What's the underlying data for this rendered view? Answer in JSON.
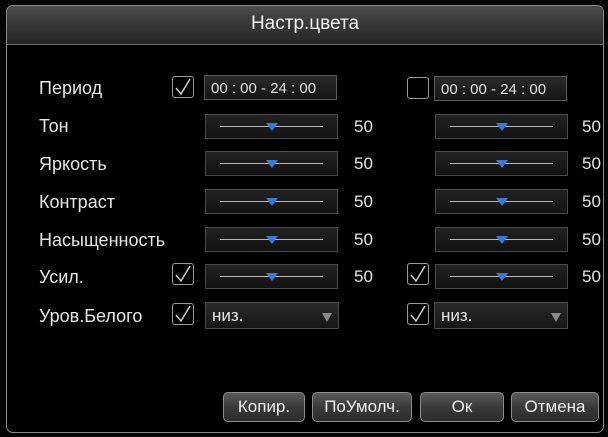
{
  "dialog": {
    "title": "Настр.цвета"
  },
  "rows": {
    "period": {
      "label": "Период",
      "ch1_time": "00 : 00 - 24 : 00",
      "ch2_time": "00 : 00 - 24 : 00",
      "ch1_checked": true,
      "ch2_checked": false
    },
    "tone": {
      "label": "Тон",
      "ch1_value": "50",
      "ch2_value": "50"
    },
    "brightness": {
      "label": "Яркость",
      "ch1_value": "50",
      "ch2_value": "50"
    },
    "contrast": {
      "label": "Контраст",
      "ch1_value": "50",
      "ch2_value": "50"
    },
    "saturation": {
      "label": "Насыщенность",
      "ch1_value": "50",
      "ch2_value": "50"
    },
    "gain": {
      "label": "Усил.",
      "ch1_value": "50",
      "ch2_value": "50",
      "ch1_checked": true,
      "ch2_checked": true
    },
    "white_level": {
      "label": "Уров.Белого",
      "ch1_value": "низ.",
      "ch2_value": "низ.",
      "ch1_checked": true,
      "ch2_checked": true
    }
  },
  "slider_level": 0.5,
  "buttons": {
    "copy": "Копир.",
    "default": "ПоУмолч.",
    "ok": "Ок",
    "cancel": "Отмена"
  },
  "colors": {
    "accent": "#3c78d8",
    "background": "#000000",
    "text": "#e6e6e6"
  }
}
